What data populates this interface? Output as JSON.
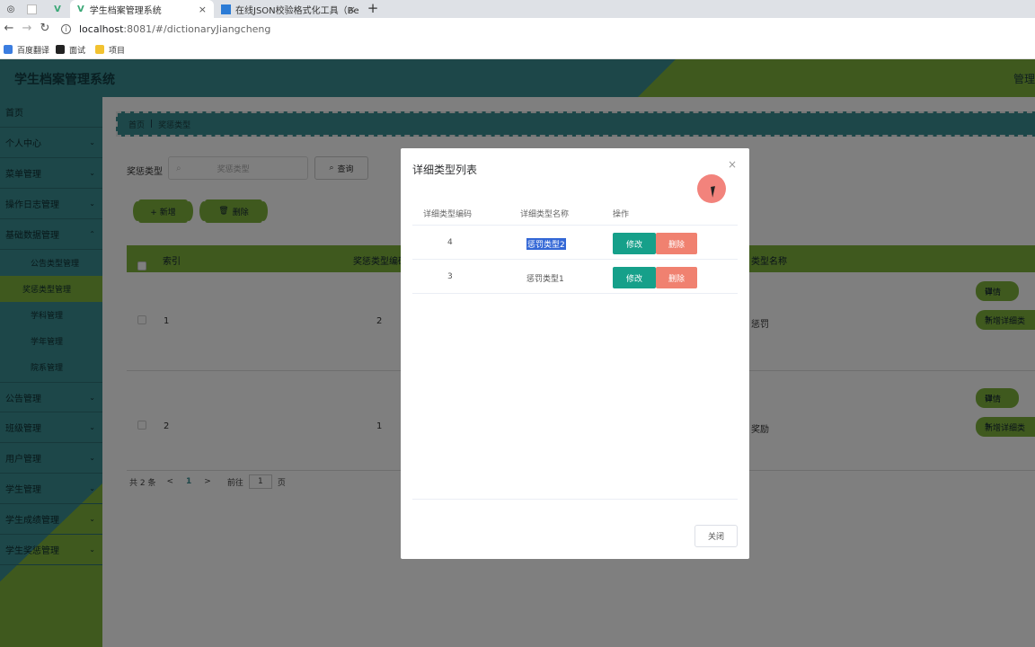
{
  "browser": {
    "tabs": [
      {
        "label": "学生档案管理系统",
        "close": "×"
      },
      {
        "label": "在线JSON校验格式化工具（Be",
        "close": "×"
      }
    ],
    "new_tab": "+",
    "url_host": "localhost",
    "url_path": ":8081/#/dictionaryJiangcheng",
    "bookmarks": [
      "百度翻译",
      "面试",
      "项目"
    ]
  },
  "app": {
    "title": "学生档案管理系统",
    "user_menu": "管理"
  },
  "sidebar": {
    "items": [
      {
        "label": "首页"
      },
      {
        "label": "个人中心"
      },
      {
        "label": "菜单管理"
      },
      {
        "label": "操作日志管理"
      },
      {
        "label": "基础数据管理"
      }
    ],
    "sub_items": [
      "公告类型管理",
      "奖惩类型管理",
      "学科管理",
      "学年管理",
      "院系管理"
    ],
    "items_after": [
      "公告管理",
      "班级管理",
      "用户管理",
      "学生管理",
      "学生成绩管理",
      "学生奖惩管理"
    ],
    "chevron": "⌄"
  },
  "main": {
    "breadcrumb": {
      "home": "首页",
      "sep": "|",
      "current": "奖惩类型"
    },
    "search": {
      "label": "奖惩类型",
      "placeholder": "奖惩类型",
      "button": "查询"
    },
    "actions": {
      "add": "+ 新增",
      "delete": "删除"
    },
    "table": {
      "headers": {
        "index": "索引",
        "code": "奖惩类型编码",
        "name": "类型名称"
      },
      "rows": [
        {
          "index": "1",
          "code": "2",
          "name": "惩罚"
        },
        {
          "index": "2",
          "code": "1",
          "name": "奖励"
        }
      ],
      "row_actions": {
        "detail": "详情",
        "add_detail": "新增详细类"
      }
    },
    "pagination": {
      "total": "共 2 条",
      "prev": "<",
      "page": "1",
      "next": ">",
      "goto": "前往",
      "page_value": "1",
      "page_unit": "页"
    }
  },
  "dialog": {
    "title": "详细类型列表",
    "close_icon": "×",
    "columns": [
      "详细类型编码",
      "详细类型名称",
      "操作"
    ],
    "rows": [
      {
        "code": "4",
        "name": "惩罚类型2",
        "edit": "修改",
        "delete": "删除"
      },
      {
        "code": "3",
        "name": "惩罚类型1",
        "edit": "修改",
        "delete": "删除"
      }
    ],
    "close_button": "关闭"
  },
  "colors": {
    "teal": "#3a8e93",
    "green": "#7fb23c",
    "edit": "#16a08a",
    "delete": "#f08170"
  }
}
